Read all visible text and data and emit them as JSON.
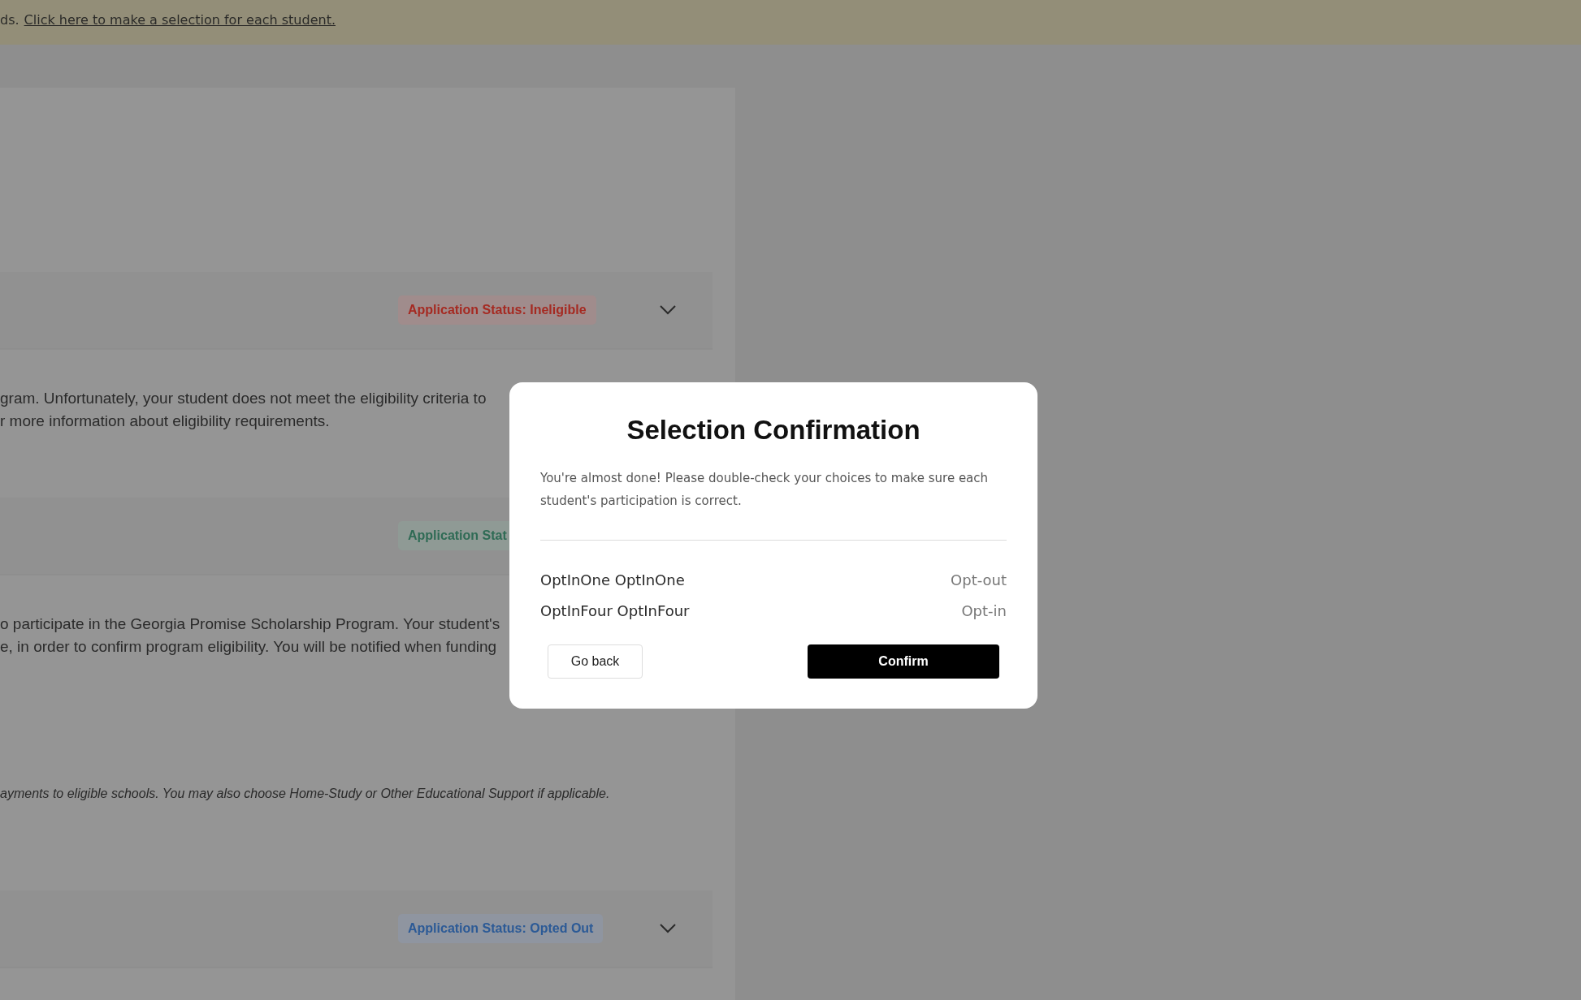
{
  "banner": {
    "text": "ds.",
    "link": "Click here to make a selection for each student."
  },
  "sections": [
    {
      "status": {
        "label": "Application Status: Ineligible",
        "kind": "ineligible"
      },
      "chevron": true,
      "body": [
        {
          "kind": "text",
          "text": "gram. Unfortunately, your student does not meet the eligibility criteria to"
        },
        {
          "kind": "text",
          "text": "r more information about eligibility requirements."
        }
      ]
    },
    {
      "status": {
        "label": "Application Stat",
        "kind": "eligible"
      },
      "body": [
        {
          "kind": "text",
          "text": "o participate in the Georgia Promise Scholarship Program. Your student's"
        },
        {
          "kind": "text",
          "text": "e, in order to confirm program eligibility. You will be notified when funding"
        },
        {
          "kind": "note",
          "text": "ayments to eligible schools. You may also choose Home-Study or Other Educational Support if applicable."
        }
      ]
    },
    {
      "status": {
        "label": "Application Status: Opted Out",
        "kind": "opted_out"
      },
      "chevron": true
    }
  ],
  "modal": {
    "title": "Selection Confirmation",
    "message": "You're almost done! Please double-check your choices to make sure each student's participation is correct.",
    "rows": [
      {
        "name": "OptInOne OptInOne",
        "choice": "Opt-out"
      },
      {
        "name": "OptInFour OptInFour",
        "choice": "Opt-in"
      }
    ],
    "buttons": [
      {
        "label": "Go back",
        "kind": "secondary"
      },
      {
        "label": "Confirm",
        "kind": "primary"
      }
    ]
  }
}
